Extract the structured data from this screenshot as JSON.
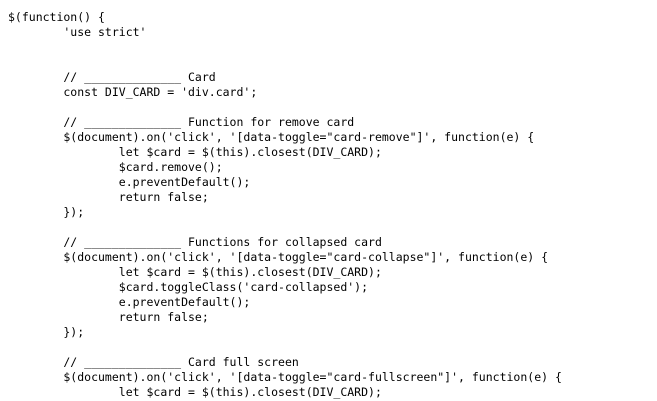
{
  "editor": {
    "lines": [
      "$(function() {",
      "        'use strict'",
      "",
      "",
      "        // ______________ Card",
      "        const DIV_CARD = 'div.card';",
      "",
      "        // ______________ Function for remove card",
      "        $(document).on('click', '[data-toggle=\"card-remove\"]', function(e) {",
      "                let $card = $(this).closest(DIV_CARD);",
      "                $card.remove();",
      "                e.preventDefault();",
      "                return false;",
      "        });",
      "",
      "        // ______________ Functions for collapsed card",
      "        $(document).on('click', '[data-toggle=\"card-collapse\"]', function(e) {",
      "                let $card = $(this).closest(DIV_CARD);",
      "                $card.toggleClass('card-collapsed');",
      "                e.preventDefault();",
      "                return false;",
      "        });",
      "",
      "        // ______________ Card full screen",
      "        $(document).on('click', '[data-toggle=\"card-fullscreen\"]', function(e) {",
      "                let $card = $(this).closest(DIV_CARD);"
    ]
  }
}
